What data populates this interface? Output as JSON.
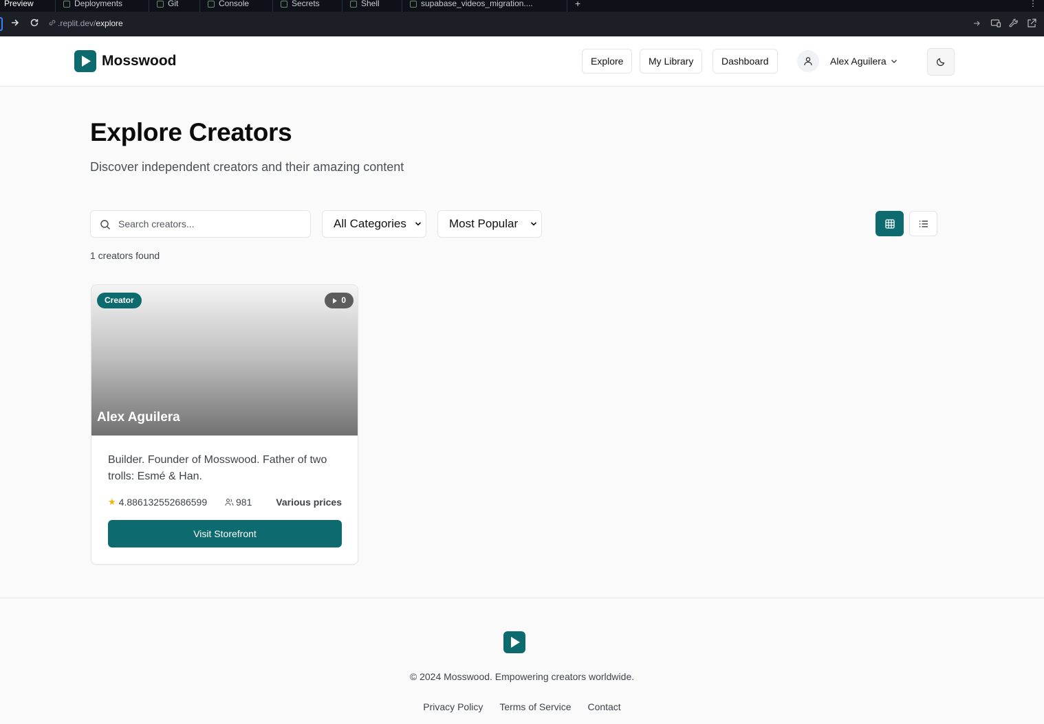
{
  "ide": {
    "tabs": [
      {
        "label": "Preview",
        "icon": "preview-icon"
      },
      {
        "label": "Deployments",
        "icon": "deploy-icon"
      },
      {
        "label": "Git",
        "icon": "git-icon"
      },
      {
        "label": "Console",
        "icon": "console-icon"
      },
      {
        "label": "Secrets",
        "icon": "lock-icon"
      },
      {
        "label": "Shell",
        "icon": "shell-icon"
      },
      {
        "label": "supabase_videos_migration....",
        "icon": "database-icon"
      }
    ],
    "url_prefix": ".replit.dev/",
    "url_path": "explore"
  },
  "header": {
    "brand": "Mosswood",
    "nav": {
      "explore": "Explore",
      "library": "My Library",
      "dashboard": "Dashboard"
    },
    "user_name": "Alex Aguilera"
  },
  "main": {
    "title": "Explore Creators",
    "subtitle": "Discover independent creators and their amazing content",
    "search_placeholder": "Search creators...",
    "category_select": "All Categories",
    "sort_select": "Most Popular",
    "results_count": "1 creators found"
  },
  "creators": [
    {
      "badge": "Creator",
      "video_count": "0",
      "name": "Alex Aguilera",
      "bio": "Builder. Founder of Mosswood. Father of two trolls: Esmé & Han.",
      "rating": "4.886132552686599",
      "subscribers": "981",
      "price": "Various prices",
      "cta": "Visit Storefront"
    }
  ],
  "footer": {
    "copyright": "© 2024 Mosswood. Empowering creators worldwide.",
    "links": {
      "privacy": "Privacy Policy",
      "terms": "Terms of Service",
      "contact": "Contact"
    }
  },
  "colors": {
    "accent": "#0d6b70",
    "star": "#f5b301"
  }
}
